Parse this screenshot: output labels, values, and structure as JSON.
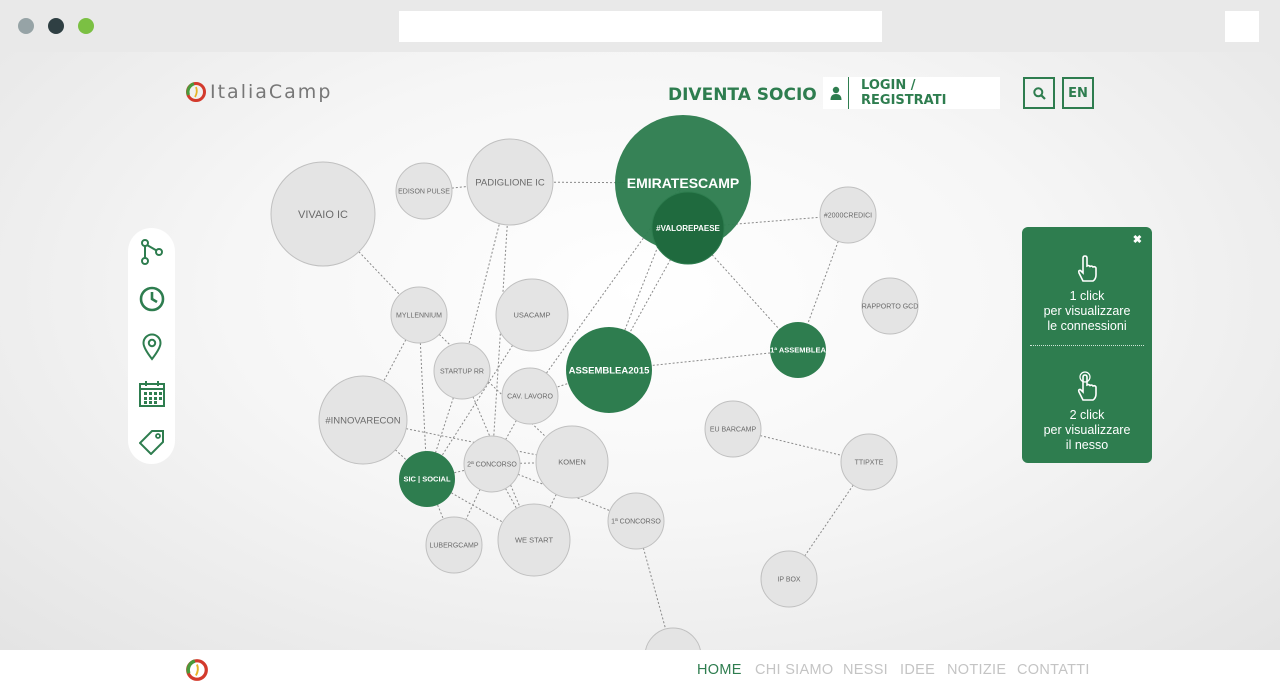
{
  "header": {
    "logo_text": "ItaliaCamp",
    "diventa_socio": "DIVENTA SOCIO",
    "login": "LOGIN / REGISTRATI",
    "lang": "EN",
    "icons": [
      "user-icon",
      "search-icon"
    ]
  },
  "toolbar": {
    "icons": [
      "connections-icon",
      "clock-icon",
      "location-pin-icon",
      "calendar-icon",
      "tag-icon"
    ]
  },
  "graph": {
    "nodes": [
      {
        "id": "emiratescamp",
        "label": "EMIRATESCAMP",
        "kind": "big-green"
      },
      {
        "id": "valorepaese",
        "label": "#VALOREPAESE",
        "kind": "dark-green"
      },
      {
        "id": "assemblea2015",
        "label": "ASSEMBLEA2015",
        "kind": "green"
      },
      {
        "id": "assemblea1",
        "label": "1ª ASSEMBLEA",
        "kind": "green"
      },
      {
        "id": "sicsocial",
        "label": "SIC | SOCIAL",
        "kind": "green"
      },
      {
        "id": "vivaio",
        "label": "VIVAIO IC",
        "kind": "gray"
      },
      {
        "id": "edison",
        "label": "EDISON PULSE",
        "kind": "gray"
      },
      {
        "id": "padiglione",
        "label": "PADIGLIONE IC",
        "kind": "gray"
      },
      {
        "id": "crediti",
        "label": "#2000CREDICI",
        "kind": "gray"
      },
      {
        "id": "rapporto",
        "label": "RAPPORTO GCD",
        "kind": "gray"
      },
      {
        "id": "myllennium",
        "label": "MYLLENNIUM",
        "kind": "gray"
      },
      {
        "id": "usacamp",
        "label": "USACAMP",
        "kind": "gray"
      },
      {
        "id": "startup",
        "label": "STARTUP RR",
        "kind": "gray"
      },
      {
        "id": "innovarecon",
        "label": "#INNOVARECON",
        "kind": "gray"
      },
      {
        "id": "cavlavoro",
        "label": "CAV. LAVORO",
        "kind": "gray"
      },
      {
        "id": "concorso2",
        "label": "2ª CONCORSO",
        "kind": "gray"
      },
      {
        "id": "komen",
        "label": "KOMEN",
        "kind": "gray"
      },
      {
        "id": "eubarcamp",
        "label": "EU BARCAMP",
        "kind": "gray"
      },
      {
        "id": "ttipxte",
        "label": "TTIPXTE",
        "kind": "gray"
      },
      {
        "id": "concorso1",
        "label": "1ª CONCORSO",
        "kind": "gray"
      },
      {
        "id": "lubergcamp",
        "label": "LUBERGCAMP",
        "kind": "gray"
      },
      {
        "id": "westart",
        "label": "WE START",
        "kind": "gray"
      },
      {
        "id": "ipbox",
        "label": "IP BOX",
        "kind": "gray"
      },
      {
        "id": "bottom",
        "label": "",
        "kind": "gray"
      }
    ],
    "edges": [
      [
        "edison",
        "padiglione"
      ],
      [
        "padiglione",
        "emiratescamp"
      ],
      [
        "valorepaese",
        "crediti"
      ],
      [
        "vivaio",
        "myllennium"
      ],
      [
        "padiglione",
        "concorso2"
      ],
      [
        "padiglione",
        "startup"
      ],
      [
        "emiratescamp",
        "assemblea2015"
      ],
      [
        "emiratescamp",
        "cavlavoro"
      ],
      [
        "valorepaese",
        "assemblea1"
      ],
      [
        "valorepaese",
        "assemblea2015"
      ],
      [
        "crediti",
        "assemblea1"
      ],
      [
        "assemblea2015",
        "assemblea1"
      ],
      [
        "assemblea2015",
        "cavlavoro"
      ],
      [
        "myllennium",
        "innovarecon"
      ],
      [
        "myllennium",
        "sicsocial"
      ],
      [
        "myllennium",
        "komen"
      ],
      [
        "usacamp",
        "sicsocial"
      ],
      [
        "startup",
        "sicsocial"
      ],
      [
        "startup",
        "westart"
      ],
      [
        "innovarecon",
        "komen"
      ],
      [
        "innovarecon",
        "sicsocial"
      ],
      [
        "sicsocial",
        "concorso2"
      ],
      [
        "sicsocial",
        "lubergcamp"
      ],
      [
        "sicsocial",
        "westart"
      ],
      [
        "cavlavoro",
        "concorso2"
      ],
      [
        "concorso2",
        "komen"
      ],
      [
        "concorso2",
        "westart"
      ],
      [
        "concorso2",
        "concorso1"
      ],
      [
        "komen",
        "westart"
      ],
      [
        "eubarcamp",
        "ttipxte"
      ],
      [
        "ttipxte",
        "ipbox"
      ],
      [
        "concorso1",
        "bottom"
      ],
      [
        "concorso2",
        "lubergcamp"
      ]
    ]
  },
  "info": {
    "click1": [
      "1 click",
      "per visualizzare",
      "le connessioni"
    ],
    "click2": [
      "2 click",
      "per visualizzare",
      "il nesso"
    ],
    "close": "✖"
  },
  "footer": {
    "nav": [
      "HOME",
      "CHI SIAMO",
      "NESSI",
      "IDEE",
      "NOTIZIE",
      "CONTATTI"
    ],
    "active": "HOME"
  },
  "colors": {
    "green": "#2e7d4f",
    "dark_green": "#1f6a3e",
    "node_gray": "#e4e4e4",
    "node_stroke": "#c0c0c0"
  }
}
